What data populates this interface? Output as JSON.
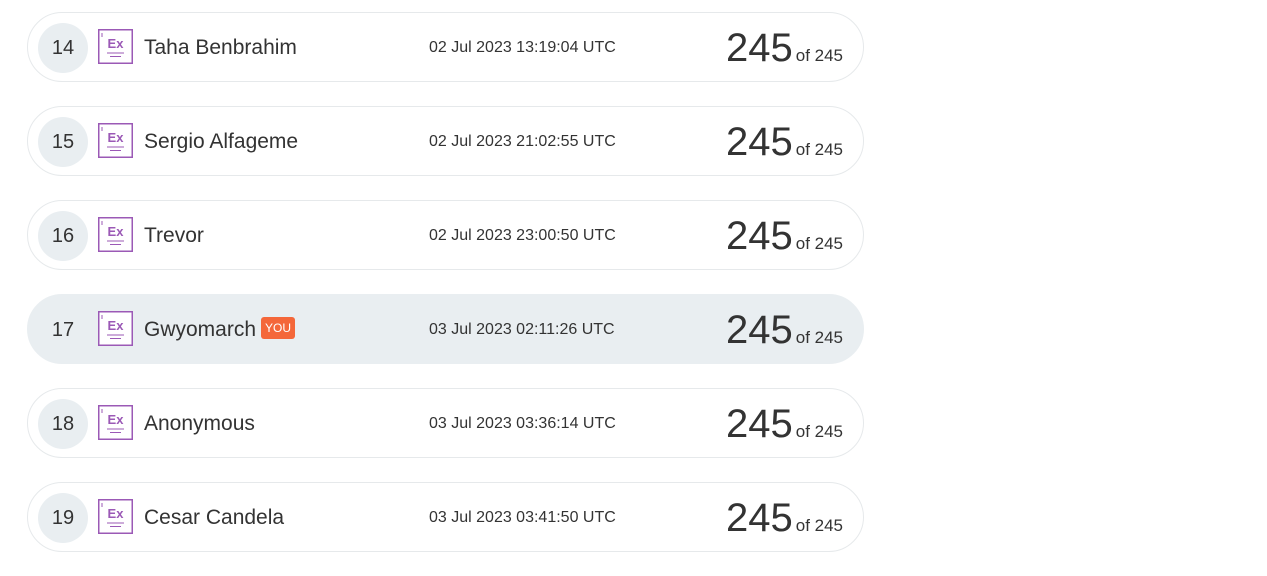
{
  "entries": [
    {
      "rank": "14",
      "name": "Taha Benbrahim",
      "badge": "",
      "time": "02 Jul 2023 13:19:04 UTC",
      "score": "245",
      "of_label": "of 245",
      "icon": "exercise-icon",
      "highlighted": false
    },
    {
      "rank": "15",
      "name": "Sergio Alfageme",
      "badge": "",
      "time": "02 Jul 2023 21:02:55 UTC",
      "score": "245",
      "of_label": "of 245",
      "icon": "exercise-icon",
      "highlighted": false
    },
    {
      "rank": "16",
      "name": "Trevor",
      "badge": "",
      "time": "02 Jul 2023 23:00:50 UTC",
      "score": "245",
      "of_label": "of 245",
      "icon": "exercise-icon",
      "highlighted": false
    },
    {
      "rank": "17",
      "name": "Gwyomarch",
      "badge": "YOU",
      "time": "03 Jul 2023 02:11:26 UTC",
      "score": "245",
      "of_label": "of 245",
      "icon": "exercise-icon",
      "highlighted": true
    },
    {
      "rank": "18",
      "name": "Anonymous",
      "badge": "",
      "time": "03 Jul 2023 03:36:14 UTC",
      "score": "245",
      "of_label": "of 245",
      "icon": "exercise-icon",
      "highlighted": false
    },
    {
      "rank": "19",
      "name": "Cesar Candela",
      "badge": "",
      "time": "03 Jul 2023 03:41:50 UTC",
      "score": "245",
      "of_label": "of 245",
      "icon": "exercise-icon",
      "highlighted": false
    }
  ],
  "icon_text": "Ex",
  "colors": {
    "icon_purple": "#9b59b6",
    "you_badge": "#f4673a",
    "highlight_row": "#e9eef1"
  }
}
